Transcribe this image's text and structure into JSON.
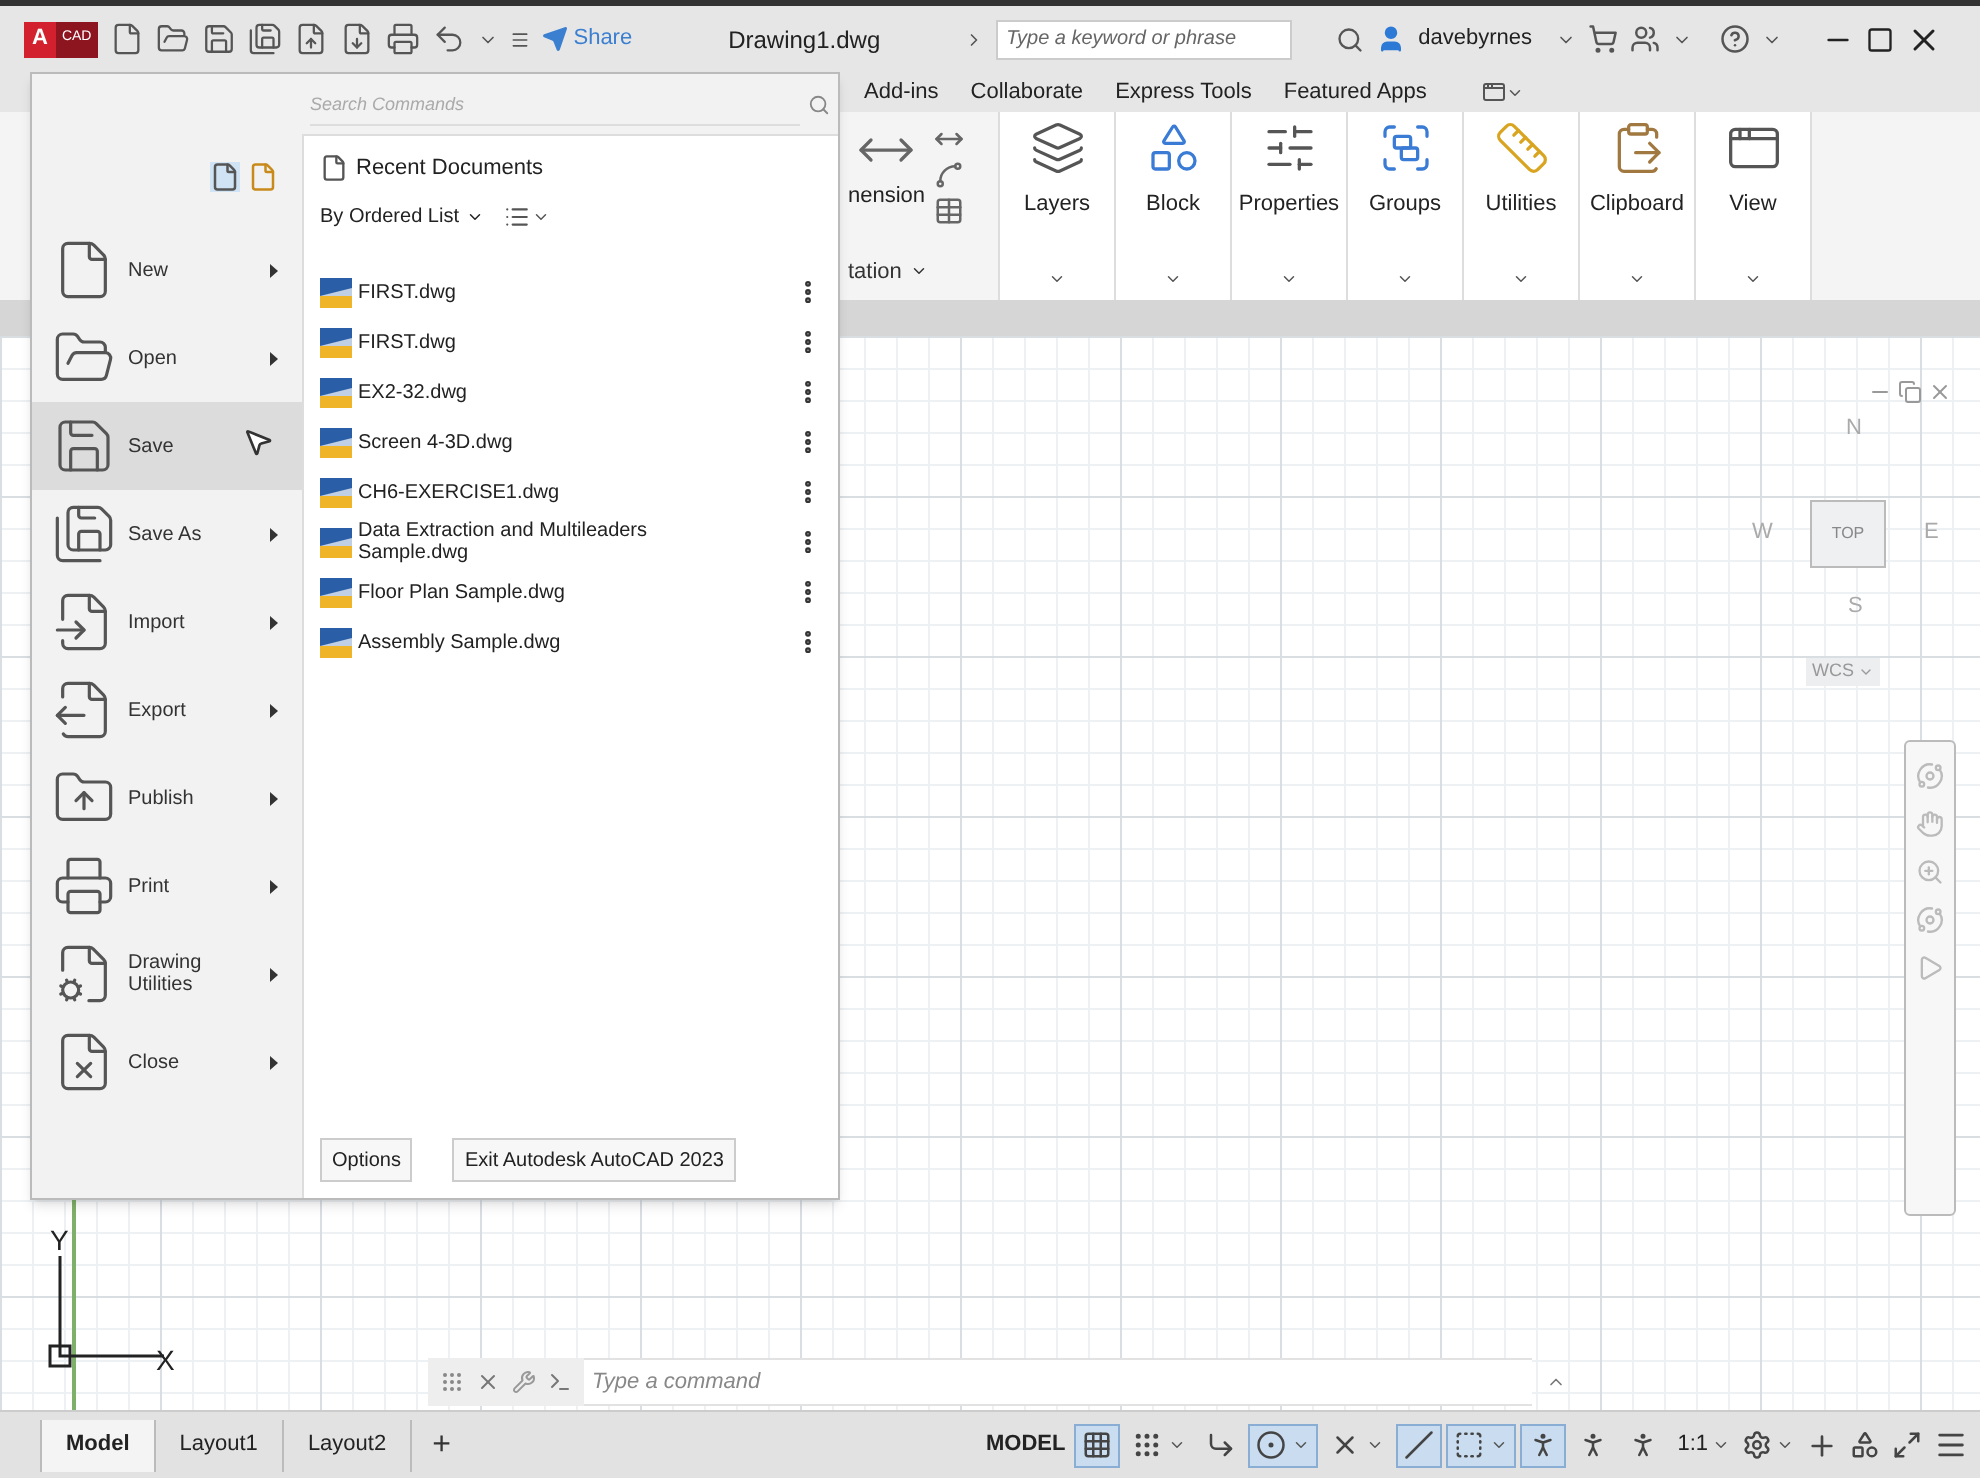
{
  "title_bar": {
    "logo": {
      "letter": "A",
      "product": "CAD"
    },
    "share": "Share",
    "document": "Drawing1.dwg",
    "search": {
      "placeholder": "Type a keyword or phrase"
    },
    "user": "davebyrnes"
  },
  "ribbon": {
    "tabs": [
      {
        "label": "Add-ins",
        "selected": false
      },
      {
        "label": "Collaborate",
        "selected": false
      },
      {
        "label": "Express Tools",
        "selected": false
      },
      {
        "label": "Featured Apps",
        "selected": false
      }
    ],
    "partial_panel": {
      "label": "nension",
      "group": "tation"
    },
    "panels": [
      {
        "kind": "layers",
        "label": "Layers"
      },
      {
        "kind": "block",
        "label": "Block"
      },
      {
        "kind": "properties",
        "label": "Properties"
      },
      {
        "kind": "groups",
        "label": "Groups"
      },
      {
        "kind": "utilities",
        "label": "Utilities"
      },
      {
        "kind": "clipboard",
        "label": "Clipboard"
      },
      {
        "kind": "view",
        "label": "View"
      }
    ]
  },
  "app_menu": {
    "search": {
      "placeholder": "Search Commands"
    },
    "items": [
      {
        "kind": "new",
        "label": "New",
        "submenu": true,
        "highlighted": false
      },
      {
        "kind": "open",
        "label": "Open",
        "submenu": true,
        "highlighted": false
      },
      {
        "kind": "save",
        "label": "Save",
        "submenu": false,
        "highlighted": true
      },
      {
        "kind": "saveas",
        "label": "Save As",
        "submenu": true,
        "highlighted": false
      },
      {
        "kind": "import",
        "label": "Import",
        "submenu": true,
        "highlighted": false
      },
      {
        "kind": "export",
        "label": "Export",
        "submenu": true,
        "highlighted": false
      },
      {
        "kind": "publish",
        "label": "Publish",
        "submenu": true,
        "highlighted": false
      },
      {
        "kind": "print",
        "label": "Print",
        "submenu": true,
        "highlighted": false
      },
      {
        "kind": "utilities",
        "label": "Drawing Utilities",
        "submenu": true,
        "highlighted": false
      },
      {
        "kind": "close",
        "label": "Close",
        "submenu": true,
        "highlighted": false
      }
    ],
    "recent": {
      "title": "Recent Documents",
      "sort": "By Ordered List",
      "files": [
        {
          "name": "FIRST.dwg"
        },
        {
          "name": "FIRST.dwg"
        },
        {
          "name": "EX2-32.dwg"
        },
        {
          "name": "Screen 4-3D.dwg"
        },
        {
          "name": "CH6-EXERCISE1.dwg"
        },
        {
          "name": "Data Extraction and Multileaders Sample.dwg"
        },
        {
          "name": "Floor Plan Sample.dwg"
        },
        {
          "name": "Assembly Sample.dwg"
        }
      ]
    },
    "buttons": [
      "Options",
      "Exit Autodesk AutoCAD 2023"
    ]
  },
  "viewcube": {
    "north": "N",
    "west": "W",
    "face": "TOP",
    "east": "E",
    "south": "S",
    "wcs": "WCS"
  },
  "ucs": {
    "x": "X",
    "y": "Y"
  },
  "command_line": {
    "placeholder": "Type a command"
  },
  "layout_tabs": [
    {
      "label": "Model",
      "selected": true
    },
    {
      "label": "Layout1",
      "selected": false
    },
    {
      "label": "Layout2",
      "selected": false
    }
  ],
  "add_tab": "+",
  "status_bar": {
    "mode": "MODEL",
    "toggles": [
      {
        "kind": "grid",
        "on": true,
        "dropdown": false
      },
      {
        "kind": "snap",
        "on": false,
        "dropdown": true
      },
      {
        "kind": "ortho",
        "on": false,
        "dropdown": false
      },
      {
        "kind": "polar",
        "on": true,
        "dropdown": true
      },
      {
        "kind": "isodraft",
        "on": false,
        "dropdown": true
      },
      {
        "kind": "tracking",
        "on": true,
        "dropdown": false
      },
      {
        "kind": "osnap",
        "on": true,
        "dropdown": true
      },
      {
        "kind": "annotation",
        "on": true,
        "dropdown": false
      },
      {
        "kind": "autoscale",
        "on": false,
        "dropdown": false
      },
      {
        "kind": "annoscale",
        "on": false,
        "dropdown": false
      }
    ],
    "scale": "1:1"
  }
}
